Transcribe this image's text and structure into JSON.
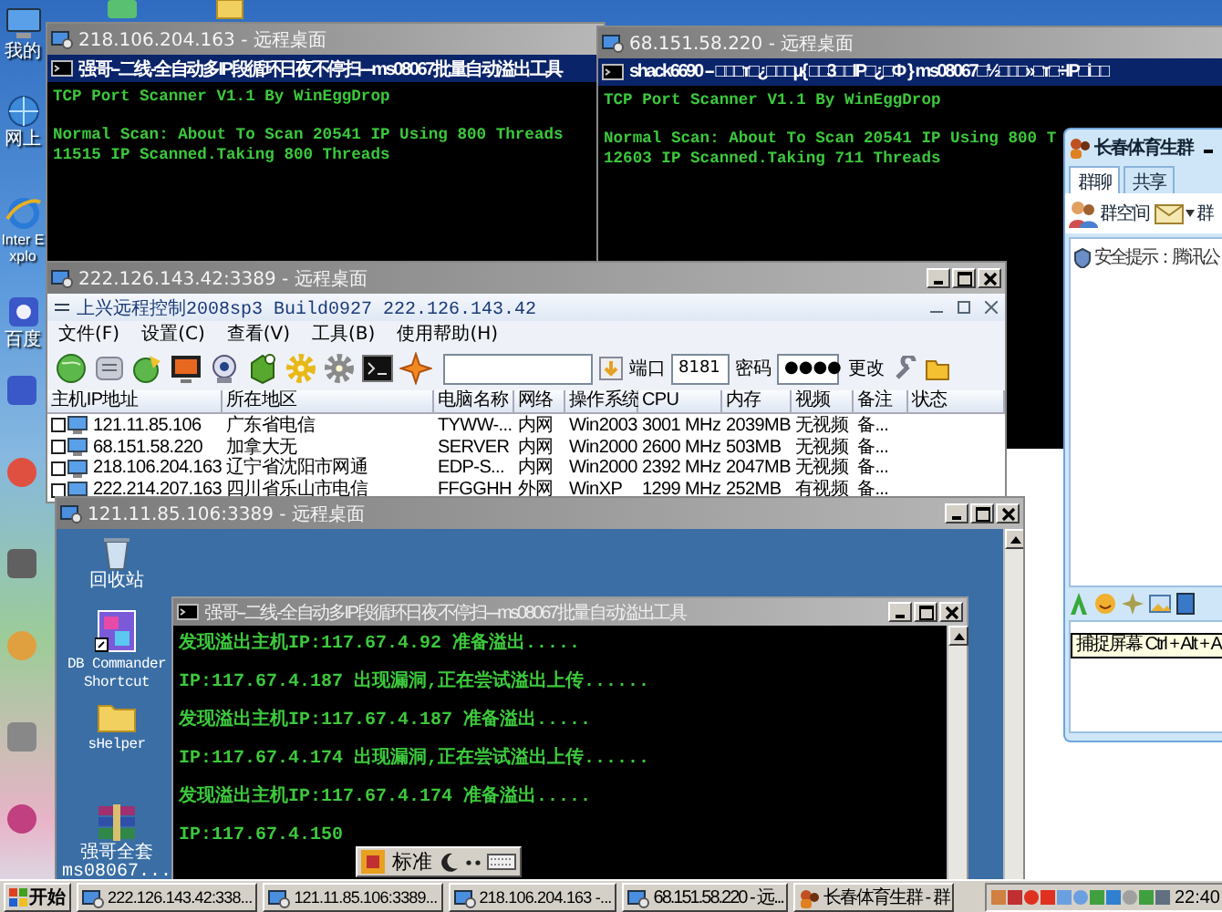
{
  "desktop_icons": [
    {
      "label": "我的",
      "kind": "computer"
    },
    {
      "label": "网上",
      "kind": "network"
    },
    {
      "label": "Inter Explo",
      "kind": "browser"
    },
    {
      "label": "百度",
      "kind": "app"
    }
  ],
  "windows": [
    {
      "kind": "console",
      "title": "218.106.204.163 - 远程桌面",
      "console": {
        "title": "强哥--二线-全自动多IP段循环日夜不停扫---ms08067批量自动溢出工具",
        "active": true,
        "blocks": [
          [
            "TCP Port Scanner V1.1 By WinEggDrop"
          ],
          [
            "Normal Scan: About To Scan 20541 IP Using 800 Threads",
            "11515 IP Scanned.Taking 800 Threads"
          ]
        ]
      }
    },
    {
      "kind": "console",
      "title": "68.151.58.220 - 远程桌面",
      "console": {
        "title": "shack6690 -- □□□т□¿□□□µ{ □□3□□IP□¿□Φ } ms08067□½□□□»□т□÷IP□i□□",
        "active": true,
        "blocks": [
          [
            "TCP Port Scanner V1.1 By WinEggDrop"
          ],
          [
            "Normal Scan: About To Scan 20541 IP Using 800 T",
            "12603 IP Scanned.Taking 711 Threads"
          ]
        ]
      }
    },
    {
      "kind": "control",
      "title": "222.126.143.42:3389 - 远程桌面",
      "app": {
        "title": "上兴远程控制2008sp3 Build0927 222.126.143.42",
        "menu": [
          "文件(F)",
          "设置(C)",
          "查看(V)",
          "工具(B)",
          "使用帮助(H)"
        ],
        "port_label": "端口",
        "port": "8181",
        "password_label": "密码",
        "password": "●●●●",
        "change_button": "更改",
        "columns": [
          "主机IP地址",
          "所在地区",
          "电脑名称",
          "网络",
          "操作系统",
          "CPU",
          "内存",
          "视频",
          "备注",
          "状态"
        ],
        "rows": [
          {
            "checked": false,
            "cells": [
              "121.11.85.106",
              "广东省电信",
              "TYWW-...",
              "内网",
              "Win2003",
              "3001 MHz",
              "2039MB",
              "无视频",
              "备..."
            ]
          },
          {
            "checked": false,
            "cells": [
              "68.151.58.220",
              "加拿大无",
              "SERVER",
              "内网",
              "Win2000",
              "2600 MHz",
              "503MB",
              "无视频",
              "备..."
            ]
          },
          {
            "checked": false,
            "cells": [
              "218.106.204.163",
              "辽宁省沈阳市网通",
              "EDP-S...",
              "内网",
              "Win2000",
              "2392 MHz",
              "2047MB",
              "无视频",
              "备..."
            ]
          },
          {
            "checked": false,
            "cells": [
              "222.214.207.163",
              "四川省乐山市电信",
              "FFGGHH",
              "外网",
              "WinXP",
              "1299 MHz",
              "252MB",
              "有视频",
              "备..."
            ]
          }
        ]
      }
    },
    {
      "kind": "desktop",
      "title": "121.11.85.106:3389 - 远程桌面",
      "desktop": {
        "icons": [
          {
            "label": "回收站",
            "kind": "recycle"
          },
          {
            "label": "DB Commander Shortcut",
            "kind": "shortcut"
          },
          {
            "label": "sHelper",
            "kind": "folder"
          },
          {
            "label": "强哥全套 ms08067...",
            "kind": "archive"
          }
        ],
        "console": {
          "title": "强哥--二线-全自动多IP段循环日夜不停扫---ms08067批量自动溢出工具",
          "active": false,
          "blocks": [
            [
              "发现溢出主机IP:117.67.4.92 准备溢出.....",
              "IP:117.67.4.187 出现漏洞,正在尝试溢出上传......",
              "发现溢出主机IP:117.67.4.187 准备溢出.....",
              "IP:117.67.4.174 出现漏洞,正在尝试溢出上传......",
              "发现溢出主机IP:117.67.4.174 准备溢出.....",
              "IP:117.67.4.150"
            ]
          ]
        },
        "ime": {
          "label": "标准"
        }
      }
    }
  ],
  "qq_window": {
    "title": "长春体育生群",
    "tabs": [
      {
        "label": "群聊",
        "selected": true
      },
      {
        "label": "共享",
        "selected": false
      }
    ],
    "toolbar": [
      "群空间",
      "群"
    ],
    "notice": "安全提示：腾讯公",
    "tooltip": "捕捉屏幕 Ctrl + Alt + A"
  },
  "taskbar": {
    "start": "开始",
    "tasks": [
      {
        "label": "222.126.143.42:338...",
        "selected": false
      },
      {
        "label": "121.11.85.106:3389...",
        "selected": false
      },
      {
        "label": "218.106.204.163 -...",
        "selected": false
      },
      {
        "label": "68.151.58.220 - 远...",
        "selected": false
      },
      {
        "label": "长春体育生群 - 群",
        "selected": false
      }
    ],
    "clock": "22:40"
  }
}
